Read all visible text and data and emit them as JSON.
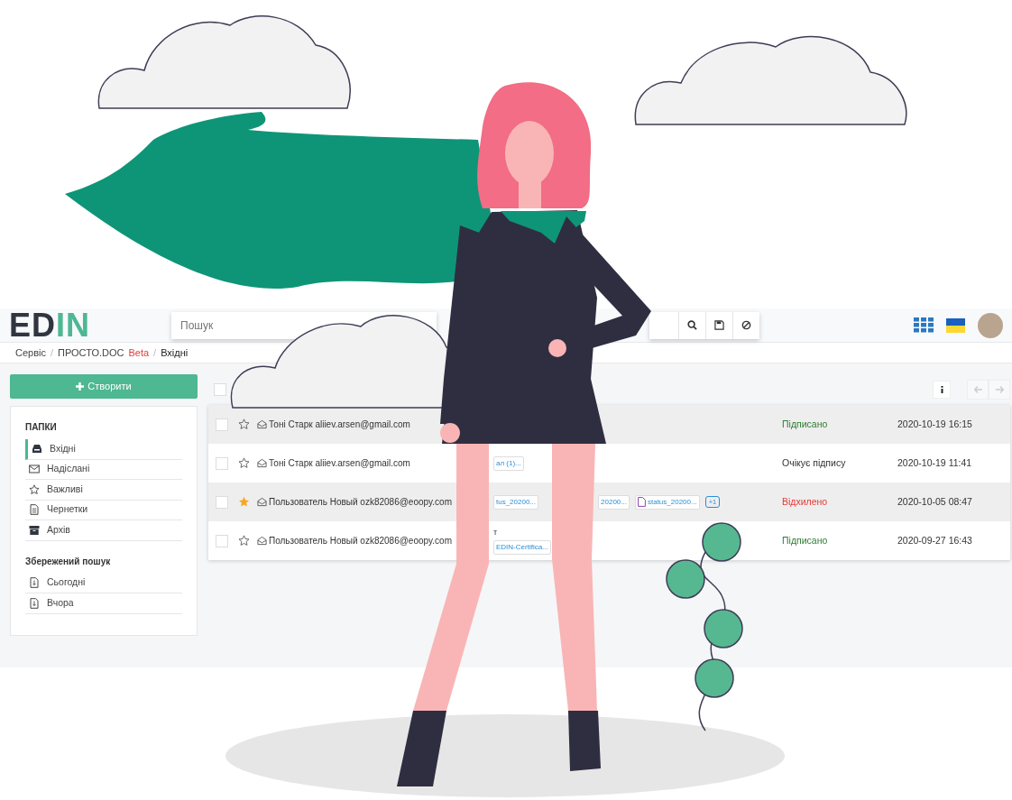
{
  "header": {
    "logo": {
      "dark": "ED",
      "accent": "IN"
    },
    "search": {
      "placeholder": "Пошук"
    }
  },
  "breadcrumb": [
    {
      "kind": "link",
      "label": "Сервіс"
    },
    {
      "kind": "separator",
      "label": "/"
    },
    {
      "kind": "link",
      "label": "ПРОСТО.DOC",
      "tag": "Beta"
    },
    {
      "kind": "separator",
      "label": "/"
    },
    {
      "kind": "current",
      "label": "Вхідні"
    }
  ],
  "create_button": "Створити",
  "folders": {
    "title": "ПАПКИ",
    "items": [
      {
        "label": "Вхідні",
        "selected": true
      },
      {
        "label": "Надіслані",
        "selected": false
      },
      {
        "label": "Важливі",
        "selected": false
      },
      {
        "label": "Чернетки",
        "selected": false
      },
      {
        "label": "Архів",
        "selected": false
      }
    ]
  },
  "saved_search": {
    "title": "Збережений пошук",
    "items": [
      {
        "label": "Сьогодні"
      },
      {
        "label": "Вчора"
      }
    ]
  },
  "toolbar": {
    "select_all_checked": false
  },
  "messages": [
    {
      "checked": false,
      "starred": false,
      "sender": "Тоні Старк aliiev.arsen@gmail.com",
      "status": "Підписано",
      "color": "#2e7d32",
      "date": "2020-10-19 16:15"
    },
    {
      "checked": false,
      "starred": false,
      "sender": "Тоні Старк aliiev.arsen@gmail.com",
      "attachments": [
        {
          "label": "ал (1)...",
          "icon": false
        }
      ],
      "status": "Очікує підпису",
      "color": "#333333",
      "date": "2020-10-19 11:41"
    },
    {
      "checked": false,
      "starred": true,
      "sender": "Пользователь Новый ozk82086@eoopy.com",
      "attachments": [
        {
          "label": "tus_20200...",
          "icon": false
        },
        {
          "label": "20200...",
          "icon": false
        },
        {
          "label": "status_20200...",
          "icon": true
        }
      ],
      "more": "+1",
      "status": "Відхилено",
      "color": "#e53935",
      "date": "2020-10-05 08:47"
    },
    {
      "checked": false,
      "starred": false,
      "sender": "Пользователь Новый ozk82086@eoopy.com",
      "subject": "т",
      "attachments": [
        {
          "label": "EDIN-Certifica...",
          "icon": false
        }
      ],
      "status": "Підписано",
      "color": "#2e7d32",
      "date": "2020-09-27 16:43"
    }
  ]
}
